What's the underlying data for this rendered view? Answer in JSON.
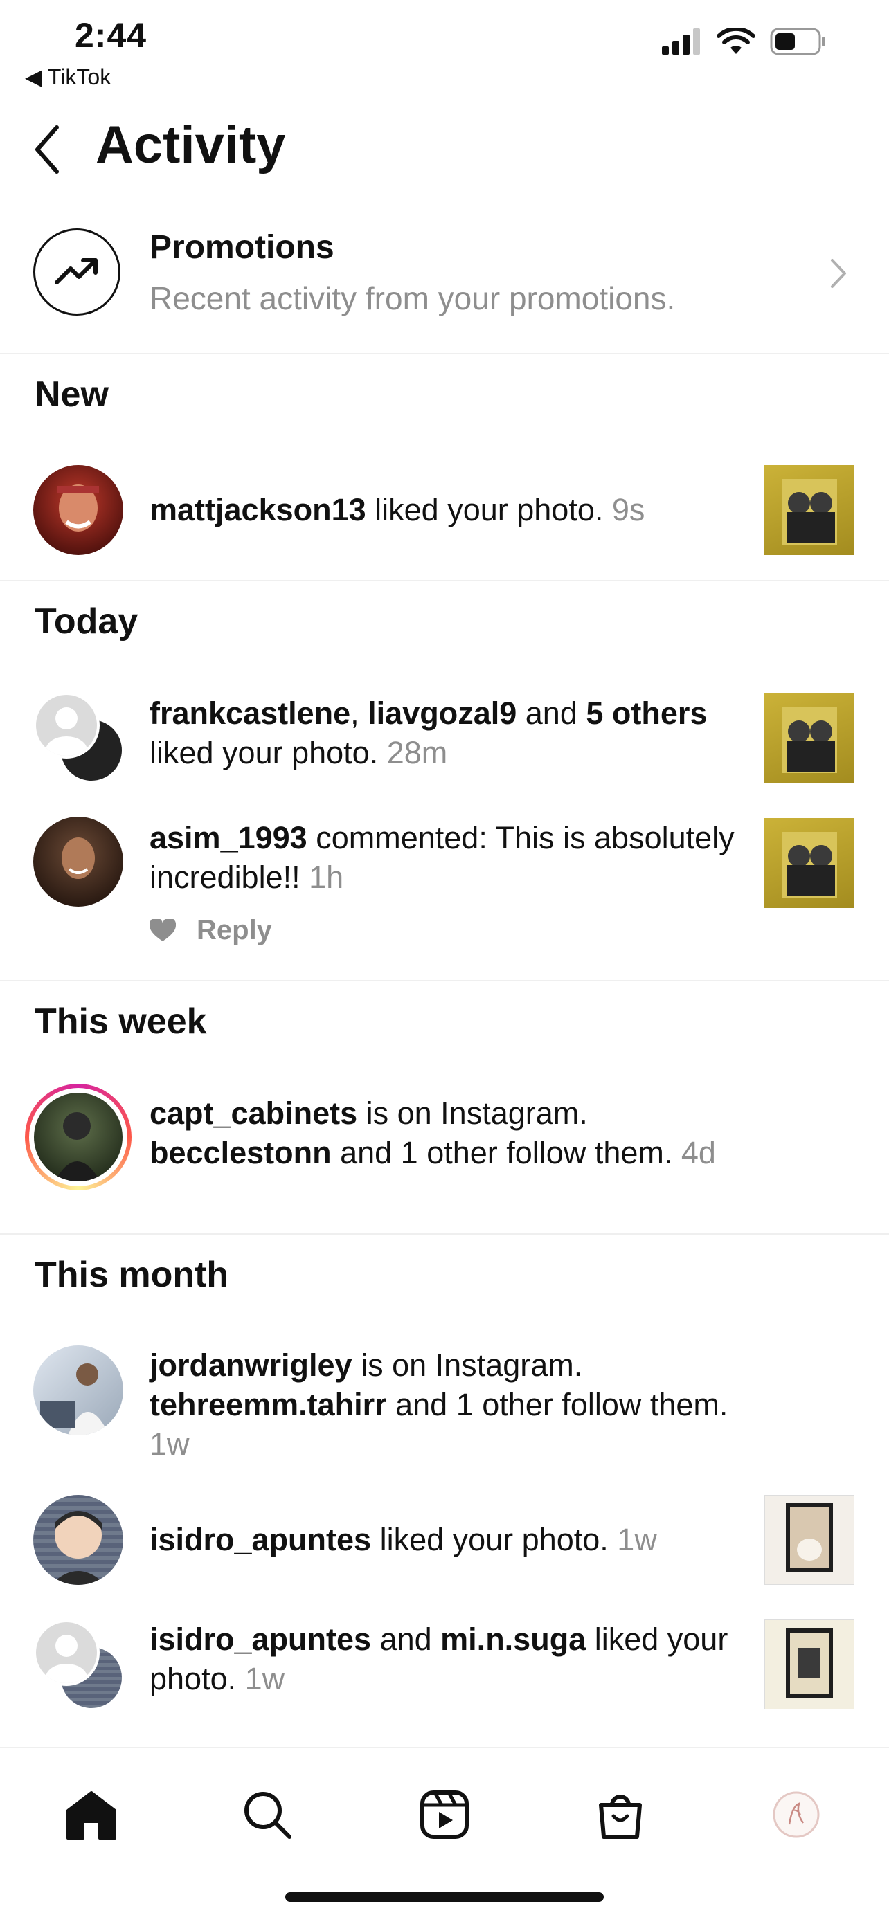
{
  "status_bar": {
    "time": "2:44",
    "back_app": "◀ TikTok"
  },
  "header": {
    "title": "Activity"
  },
  "promotions": {
    "title": "Promotions",
    "subtitle": "Recent activity from your promotions."
  },
  "sections": {
    "new": "New",
    "today": "Today",
    "this_week": "This week",
    "this_month": "This month"
  },
  "rows": {
    "r1": {
      "user": "mattjackson13",
      "text": " liked your photo. ",
      "time": "9s"
    },
    "r2": {
      "user1": "frankcastlene",
      "sep": ", ",
      "user2": "liavgozal9",
      "text1": " and ",
      "count": "5 others",
      "text2": " liked your photo. ",
      "time": "28m"
    },
    "r3": {
      "user": "asim_1993",
      "text": " commented: This is absolutely incredible!! ",
      "time": "1h",
      "reply": "Reply"
    },
    "r4": {
      "user": "capt_cabinets",
      "text1": " is on Instagram.",
      "user2": "becclestonn",
      "text2": " and 1 other follow them. ",
      "time": "4d"
    },
    "r5": {
      "user": "jordanwrigley",
      "text1": " is on Instagram.",
      "user2": "tehreemm.tahirr",
      "text2": " and 1 other follow them. ",
      "time": "1w"
    },
    "r6": {
      "user": "isidro_apuntes",
      "text": " liked your photo. ",
      "time": "1w"
    },
    "r7": {
      "user1": "isidro_apuntes",
      "text1": " and ",
      "user2": "mi.n.suga",
      "text2": " liked your photo. ",
      "time": "1w"
    }
  },
  "nav": {
    "icons": [
      "home-icon",
      "search-icon",
      "reels-icon",
      "shop-icon",
      "profile-icon"
    ]
  },
  "colors": {
    "muted": "#8e8e8e",
    "gold_thumb": "#b9a02a",
    "story_ring": "#d6249f"
  }
}
